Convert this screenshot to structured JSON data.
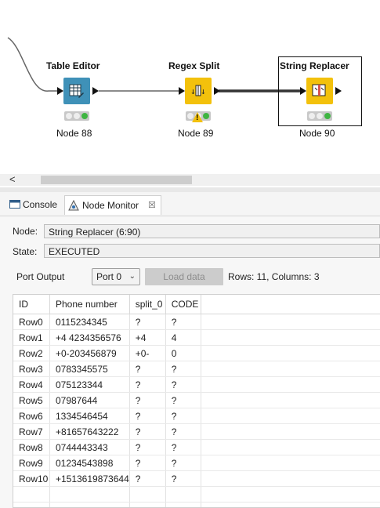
{
  "workflow": {
    "nodes": [
      {
        "title": "Table Editor",
        "label": "Node 88",
        "icon": "table-editor-icon",
        "color": "#3f91b8"
      },
      {
        "title": "Regex Split",
        "label": "Node 89",
        "icon": "regex-split-icon",
        "color": "#f3c10c",
        "warning": "!"
      },
      {
        "title": "String Replacer",
        "label": "Node 90",
        "icon": "string-replacer-icon",
        "color": "#f3c10c"
      }
    ],
    "scroll_left": "<"
  },
  "tabs": [
    {
      "label": "Console",
      "icon": "console-icon"
    },
    {
      "label": "Node Monitor",
      "icon": "node-monitor-icon",
      "close": "☒"
    }
  ],
  "monitor": {
    "node_label": "Node:",
    "node_value": "String Replacer  (6:90)",
    "state_label": "State:",
    "state_value": "EXECUTED",
    "port_output_label": "Port Output",
    "port_select": "Port 0",
    "load_button": "Load data",
    "rows_info": "Rows: 11, Columns: 3"
  },
  "table": {
    "headers": [
      "ID",
      "Phone number",
      "split_0",
      "CODE"
    ],
    "rows": [
      [
        "Row0",
        "0115234345",
        "?",
        "?"
      ],
      [
        "Row1",
        "+4 4234356576",
        "+4",
        "4"
      ],
      [
        "Row2",
        "+0-203456879",
        "+0-",
        "0"
      ],
      [
        "Row3",
        "0783345575",
        "?",
        "?"
      ],
      [
        "Row4",
        "075123344",
        "?",
        "?"
      ],
      [
        "Row5",
        "07987644",
        "?",
        "?"
      ],
      [
        "Row6",
        "1334546454",
        "?",
        "?"
      ],
      [
        "Row7",
        "+81657643222",
        "?",
        "?"
      ],
      [
        "Row8",
        "0744443343",
        "?",
        "?"
      ],
      [
        "Row9",
        "01234543898",
        "?",
        "?"
      ],
      [
        "Row10",
        "+1513619873644",
        "?",
        "?"
      ]
    ]
  }
}
